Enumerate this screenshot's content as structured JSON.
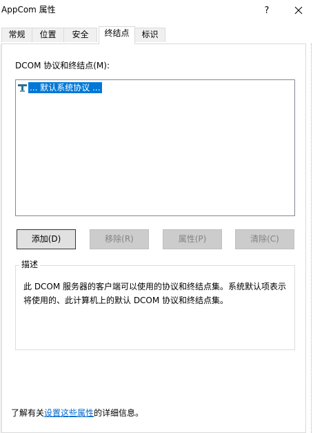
{
  "window": {
    "title": "AppCom 属性",
    "help_glyph": "?",
    "close_icon": "close-icon"
  },
  "tabs": [
    {
      "label": "常规",
      "selected": false
    },
    {
      "label": "位置",
      "selected": false
    },
    {
      "label": "安全",
      "selected": false
    },
    {
      "label": "终结点",
      "selected": true
    },
    {
      "label": "标识",
      "selected": false
    }
  ],
  "endpoints": {
    "label": "DCOM 协议和终结点(M):",
    "items": [
      {
        "text": "... 默认系统协议 ...",
        "selected": true,
        "icon": "protocol-connector-icon"
      }
    ]
  },
  "buttons": {
    "add": "添加(D)",
    "remove": "移除(R)",
    "properties": "属性(P)",
    "clear": "清除(C)"
  },
  "description": {
    "legend": "描述",
    "text": "此 DCOM 服务器的客户端可以使用的协议和终结点集。系统默认项表示将使用的、此计算机上的默认 DCOM 协议和终结点集。"
  },
  "footer": {
    "prefix": "了解有关",
    "link": "设置这些属性",
    "suffix": "的详细信息。"
  },
  "colors": {
    "selection": "#0078d7",
    "link": "#0066cc",
    "dialog_bg": "#f0f0f0",
    "disabled_text": "#838383"
  }
}
